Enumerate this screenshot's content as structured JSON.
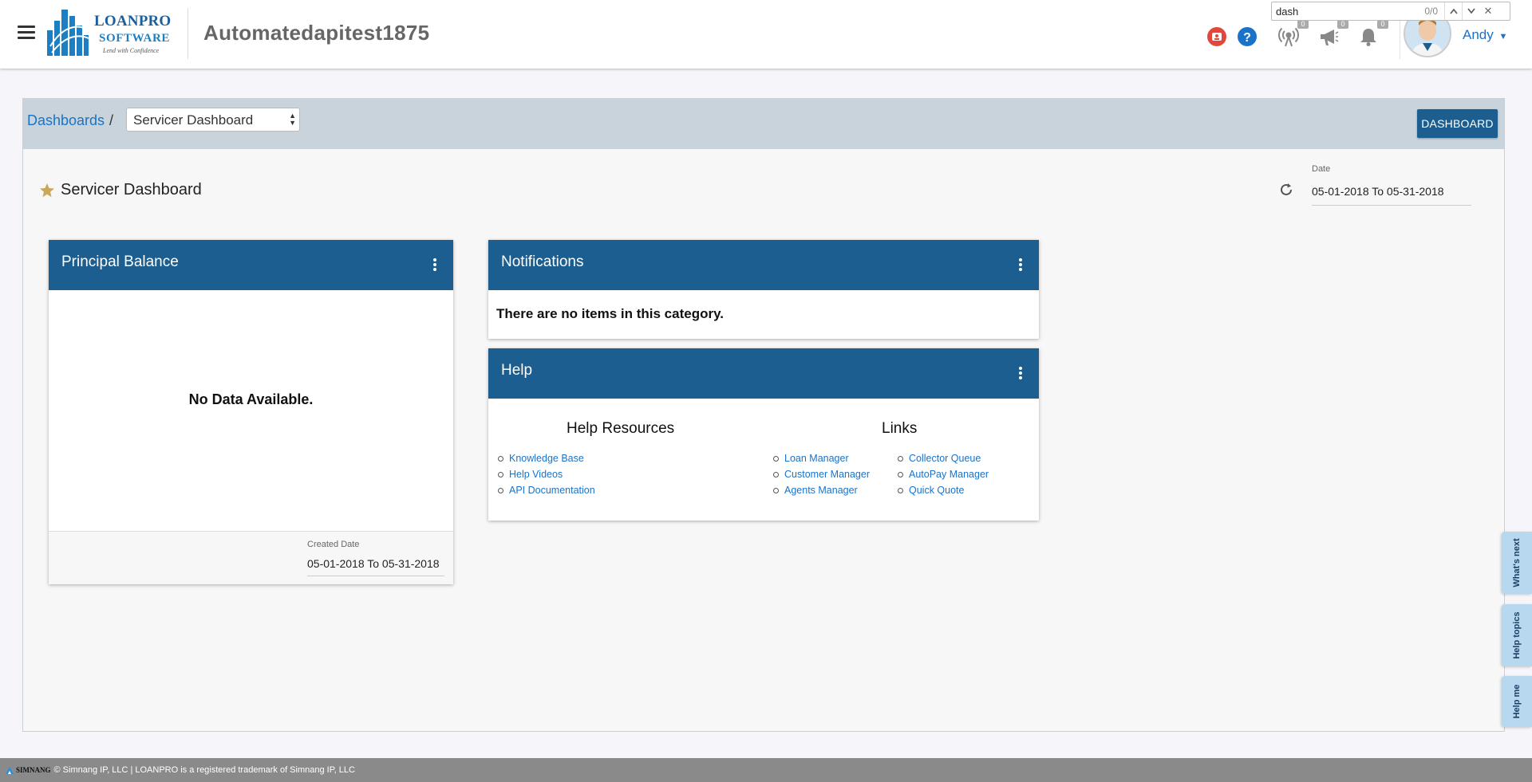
{
  "app": {
    "title": "Automatedapitest1875",
    "logo_name": "LOANPRO",
    "logo_sub": "SOFTWARE",
    "logo_tagline": "Lend with Confidence"
  },
  "header": {
    "user_name": "Andy",
    "badges": {
      "broadcast": "0",
      "announcements": "0",
      "notifications": "0"
    }
  },
  "findbar": {
    "value": "dash",
    "count": "0/0"
  },
  "breadcrumb": {
    "root": "Dashboards",
    "separator": "/",
    "selected": "Servicer Dashboard"
  },
  "dashboard_button": "DASHBOARD",
  "page": {
    "title": "Servicer Dashboard",
    "date_label": "Date",
    "date_value": "05-01-2018 To 05-31-2018"
  },
  "widgets": {
    "principal": {
      "title": "Principal Balance",
      "empty_text": "No Data Available.",
      "created_label": "Created Date",
      "created_value": "05-01-2018 To 05-31-2018"
    },
    "notifications": {
      "title": "Notifications",
      "empty_text": "There are no items in this category."
    },
    "help": {
      "title": "Help",
      "resources_title": "Help Resources",
      "resources": [
        "Knowledge Base",
        "Help Videos",
        "API Documentation"
      ],
      "links_title": "Links",
      "links_col1": [
        "Loan Manager",
        "Customer Manager",
        "Agents Manager"
      ],
      "links_col2": [
        "Collector Queue",
        "AutoPay Manager",
        "Quick Quote"
      ]
    }
  },
  "side_tabs": [
    "What's next",
    "Help topics",
    "Help me"
  ],
  "footer": {
    "brand": "SIMNANG",
    "text": "© Simnang IP, LLC | LOANPRO is a registered trademark of Simnang IP, LLC"
  },
  "colors": {
    "brand_blue": "#1b5e8f",
    "link_blue": "#1a73c8",
    "alert_red": "#e2473b",
    "help_blue": "#1a73c8"
  },
  "icons": [
    "menu-icon",
    "support-icon",
    "help-icon",
    "broadcast-icon",
    "megaphone-icon",
    "bell-icon",
    "caret-down-icon",
    "star-icon",
    "refresh-icon",
    "kebab-menu-icon"
  ]
}
